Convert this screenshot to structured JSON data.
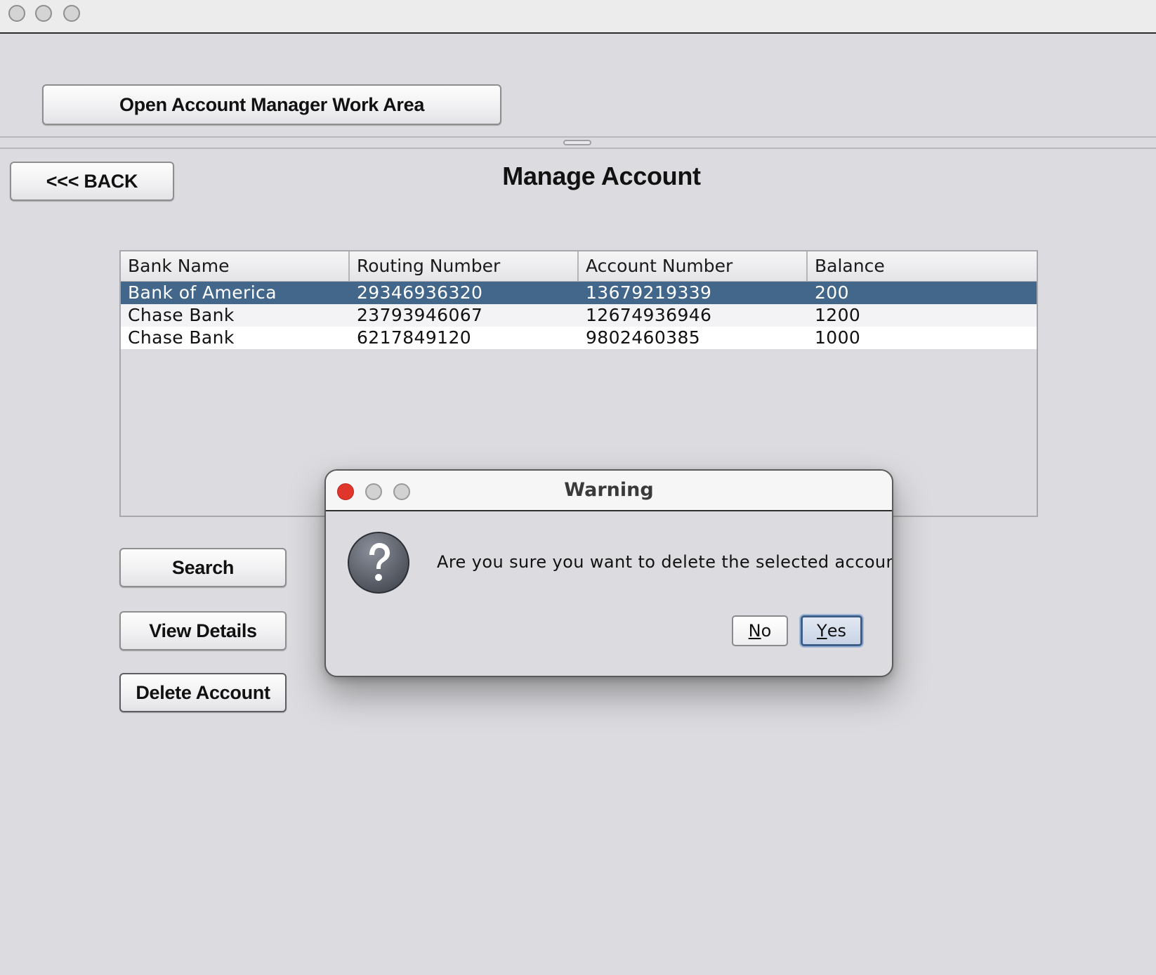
{
  "window": {
    "title": ""
  },
  "top_panel": {
    "open_work_area_label": "Open Account Manager Work Area"
  },
  "main": {
    "back_label": "<<< BACK",
    "title": "Manage Account",
    "table": {
      "columns": [
        "Bank Name",
        "Routing Number",
        "Account Number",
        "Balance"
      ],
      "rows": [
        [
          "Bank of America",
          "29346936320",
          "13679219339",
          "200"
        ],
        [
          "Chase Bank",
          "23793946067",
          "12674936946",
          "1200"
        ],
        [
          "Chase Bank",
          "6217849120",
          "9802460385",
          "1000"
        ]
      ],
      "selected_row": 0
    },
    "buttons": {
      "search_label": "Search",
      "view_details_label": "View Details",
      "delete_label": "Delete Account"
    }
  },
  "dialog": {
    "title": "Warning",
    "icon": "question-icon",
    "message": "Are you sure you want to delete the selected account?",
    "no": {
      "mnemonic": "N",
      "rest": "o"
    },
    "yes": {
      "mnemonic": "Y",
      "rest": "es"
    },
    "default_button": "Yes"
  },
  "colors": {
    "window_bg": "#dcdce0",
    "selection": "#43678a",
    "close_red": "#e0352b"
  }
}
